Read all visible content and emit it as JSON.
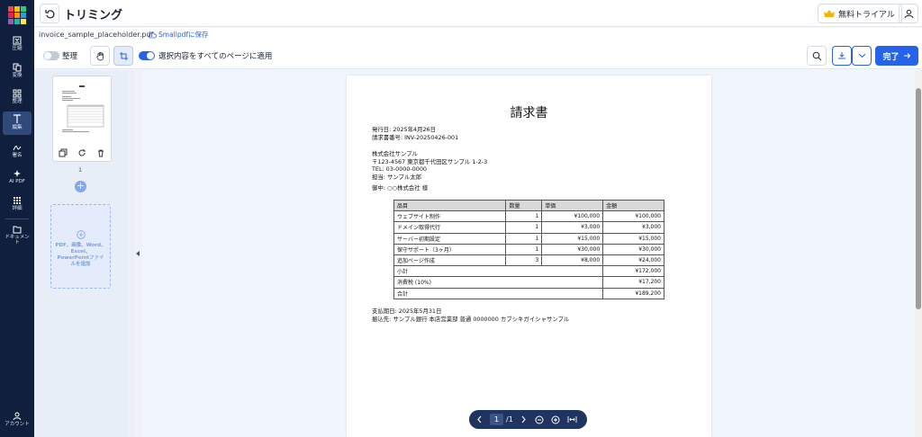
{
  "colors": {
    "nav_bg": "#0f1f3d",
    "accent": "#2563eb",
    "pager_bg": "#1f3460"
  },
  "nav": {
    "items": [
      {
        "icon": "compress-icon",
        "label": "圧縮"
      },
      {
        "icon": "convert-icon",
        "label": "変換"
      },
      {
        "icon": "organize-icon",
        "label": "整理"
      },
      {
        "icon": "edit-text-icon",
        "label": "編集"
      },
      {
        "icon": "sign-icon",
        "label": "署名"
      },
      {
        "icon": "ai-sparkle-icon",
        "label": "AI PDF"
      },
      {
        "icon": "grid-icon",
        "label": "詳細"
      },
      {
        "icon": "document-folder-icon",
        "label": "ドキュメント"
      }
    ],
    "account_label": "アカウント"
  },
  "header": {
    "title": "トリミング",
    "trial_label": "無料トライアル"
  },
  "file": {
    "name": "invoice_sample_placeholder.pdf",
    "save_label": "Smallpdfに保存"
  },
  "toolbar": {
    "organize_label": "整理",
    "apply_all_label": "選択内容をすべてのページに適用",
    "done_label": "完了"
  },
  "thumbnails": {
    "page_number": "1",
    "dropzone_text": "PDF、画像、Word、Excel、PowerPointファイルを追加"
  },
  "invoice": {
    "title": "請求書",
    "issue_date": "発行日: 2025年4月26日",
    "invoice_no": "請求書番号: INV-20250426-001",
    "company": "株式会社サンプル",
    "address": "〒123-4567 東京都千代田区サンプル 1-2-3",
    "tel": "TEL: 03-0000-0000",
    "contact": "担当: サンプル太郎",
    "recipient": "御中: ○○株式会社 様",
    "headers": [
      "品目",
      "数量",
      "単価",
      "金額"
    ],
    "rows": [
      {
        "item": "ウェブサイト制作",
        "qty": "1",
        "price": "¥100,000",
        "amount": "¥100,000"
      },
      {
        "item": "ドメイン取得代行",
        "qty": "1",
        "price": "¥3,000",
        "amount": "¥3,000"
      },
      {
        "item": "サーバー初期設定",
        "qty": "1",
        "price": "¥15,000",
        "amount": "¥15,000"
      },
      {
        "item": "保守サポート（3ヶ月）",
        "qty": "1",
        "price": "¥30,000",
        "amount": "¥30,000"
      },
      {
        "item": "追加ページ作成",
        "qty": "3",
        "price": "¥8,000",
        "amount": "¥24,000"
      }
    ],
    "subtotal_label": "小計",
    "subtotal": "¥172,000",
    "tax_label": "消費税 (10%)",
    "tax": "¥17,200",
    "total_label": "合計",
    "total": "¥189,200",
    "due_date": "支払期日: 2025年5月31日",
    "bank": "振込先: サンプル銀行 本店営業部 普通 0000000 カブシキガイシャサンプル"
  },
  "pager": {
    "current": "1",
    "total": "/1"
  }
}
